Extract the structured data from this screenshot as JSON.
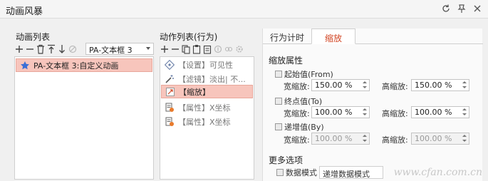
{
  "window": {
    "title": "动画风暴"
  },
  "left": {
    "label": "动画列表",
    "combo_value": "PA-文本框 3",
    "rows": [
      {
        "label": "PA-文本框 3:自定义动画"
      }
    ]
  },
  "middle": {
    "label": "动作列表(行为)",
    "rows": [
      {
        "label": "【设置】可见性"
      },
      {
        "label": "【滤镜】淡出| 不..."
      },
      {
        "label": "【缩放】"
      },
      {
        "label": "【属性】X坐标"
      },
      {
        "label": "【属性】X坐标"
      }
    ]
  },
  "right": {
    "tabs": [
      {
        "label": "行为计时"
      },
      {
        "label": "缩放"
      }
    ],
    "scale_title": "缩放属性",
    "from": {
      "label": "起始值(From)",
      "w_label": "宽缩放:",
      "w_value": "150.00 %",
      "h_label": "高缩放:",
      "h_value": "150.00 %"
    },
    "to": {
      "label": "终点值(To)",
      "w_label": "宽缩放:",
      "w_value": "100.00 %",
      "h_label": "高缩放:",
      "h_value": "100.00 %"
    },
    "by": {
      "label": "递增值(By)",
      "w_label": "宽缩放:",
      "w_value": "100.00 %",
      "h_label": "高缩放:",
      "h_value": "100.00 %"
    },
    "more_title": "更多选项",
    "mode_label": "数据模式",
    "mode_value": "递增数据模式"
  },
  "watermark": "www.cfan.com.cn"
}
